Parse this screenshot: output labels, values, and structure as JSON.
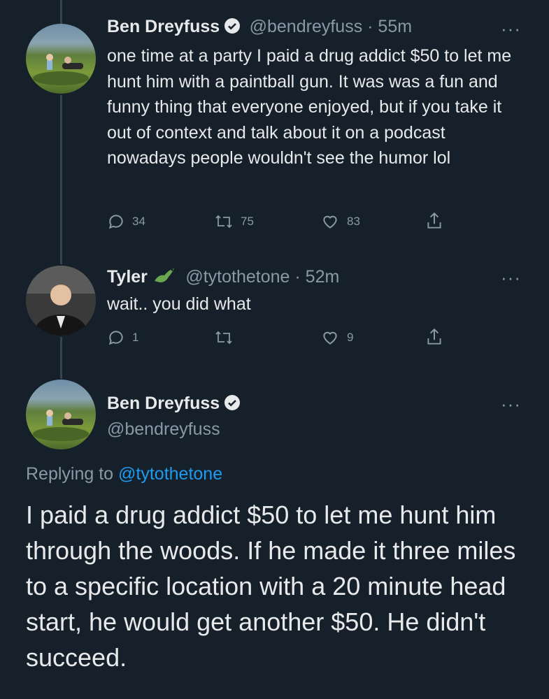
{
  "tweet1": {
    "name": "Ben Dreyfuss",
    "handle_time": "@bendreyfuss · 55m",
    "text": "one time at a party I paid a drug addict $50 to let me hunt him with a paintball gun. It was was a fun and funny thing that everyone enjoyed, but if you take it out of context and talk about it on a podcast nowadays people wouldn't see the humor lol",
    "replies": "34",
    "retweets": "75",
    "likes": "83"
  },
  "tweet2": {
    "name": "Tyler",
    "handle_time": "@tytothetone · 52m",
    "text": "wait.. you did what",
    "replies": "1",
    "retweets": "",
    "likes": "9"
  },
  "main": {
    "name": "Ben Dreyfuss",
    "handle": "@bendreyfuss",
    "replying_prefix": "Replying to ",
    "replying_to": "@tytothetone",
    "text": "I paid a drug addict $50 to let me hunt him through the woods. If he made it three miles to a specific location with a 20 minute head start, he would get another $50. He didn't succeed."
  },
  "icons": {
    "more": "more-icon",
    "reply": "reply-icon",
    "retweet": "retweet-icon",
    "like": "like-icon",
    "share": "share-icon",
    "verified": "verified-badge-icon",
    "emoji": "lizard-emoji-icon"
  },
  "colors": {
    "background": "#15202b",
    "text": "#e7e9ea",
    "muted": "#8b98a5",
    "link": "#1d9bf0"
  }
}
